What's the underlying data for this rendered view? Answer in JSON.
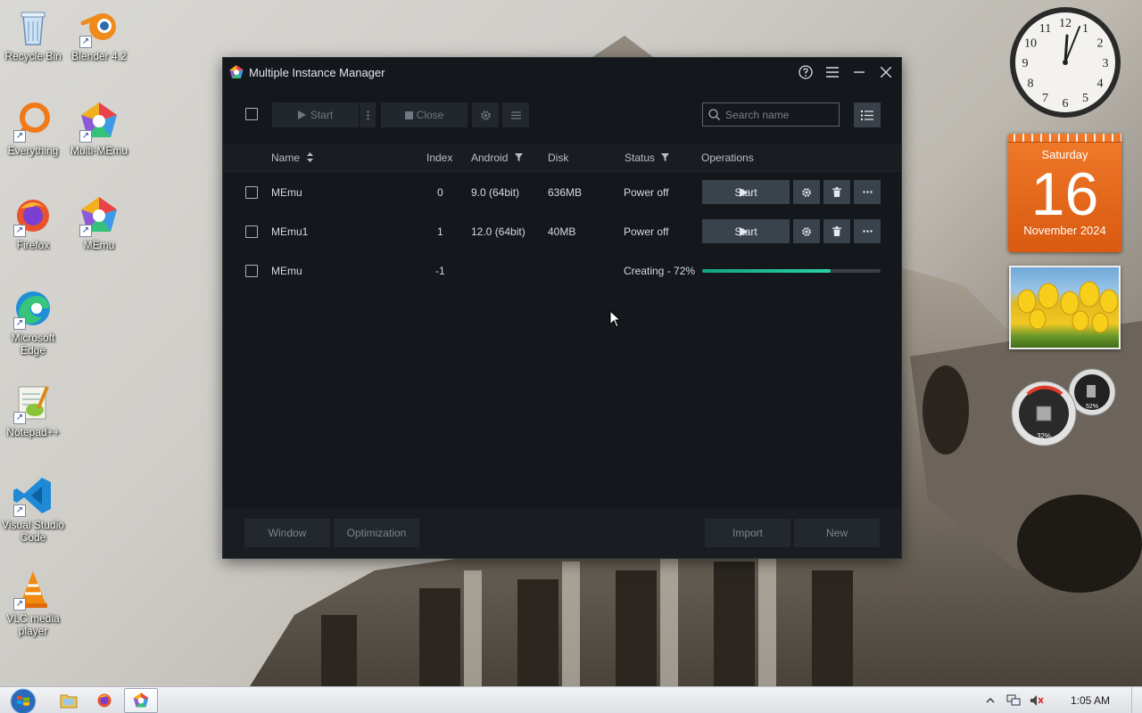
{
  "desktop": {
    "icons": [
      {
        "label": "Recycle Bin"
      },
      {
        "label": "Blender 4.2"
      },
      {
        "label": "Everything"
      },
      {
        "label": "Multi-MEmu"
      },
      {
        "label": "Firefox"
      },
      {
        "label": "MEmu"
      },
      {
        "label": "Microsoft Edge"
      },
      {
        "label": "Notepad++"
      },
      {
        "label": "Visual Studio Code"
      },
      {
        "label": "VLC media player"
      }
    ]
  },
  "gadgets": {
    "calendar": {
      "weekday": "Saturday",
      "day": "16",
      "month_year": "November 2024"
    },
    "clock_numbers": [
      "12",
      "1",
      "2",
      "3",
      "4",
      "5",
      "6",
      "7",
      "8",
      "9",
      "10",
      "11"
    ],
    "meter": {
      "cpu": "32%",
      "memory": "52%"
    }
  },
  "window": {
    "title": "Multiple Instance Manager",
    "toolbar": {
      "start_label": "Start",
      "close_label": "Close",
      "search_placeholder": "Search name"
    },
    "columns": {
      "name": "Name",
      "index": "Index",
      "android": "Android",
      "disk": "Disk",
      "status": "Status",
      "operations": "Operations"
    },
    "rows": [
      {
        "name": "MEmu",
        "index": "0",
        "android": "9.0 (64bit)",
        "disk": "636MB",
        "status": "Power off",
        "op_label": "Start"
      },
      {
        "name": "MEmu1",
        "index": "1",
        "android": "12.0 (64bit)",
        "disk": "40MB",
        "status": "Power off",
        "op_label": "Start"
      },
      {
        "name": "MEmu",
        "index": "-1",
        "android": "",
        "disk": "",
        "status": "Creating - 72%",
        "progress": 0.72
      }
    ],
    "footer": {
      "window_label": "Window",
      "optimization_label": "Optimization",
      "import_label": "Import",
      "new_label": "New"
    }
  },
  "taskbar": {
    "time": "1:05 AM"
  },
  "colors": {
    "window_bg": "#14171b",
    "accent_progress": "#2bd1a6",
    "calendar": "#e8681c"
  }
}
